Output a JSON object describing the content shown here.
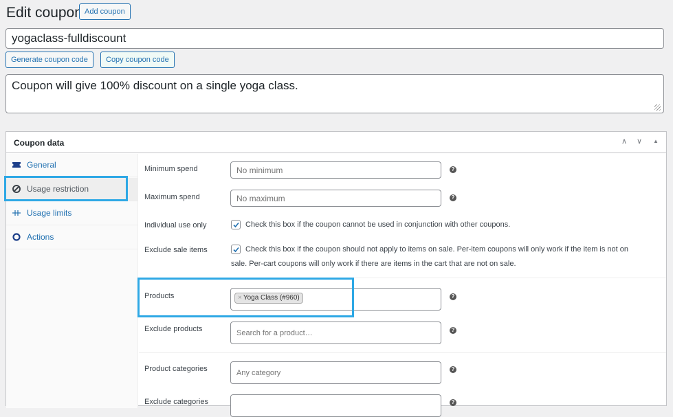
{
  "header": {
    "title": "Edit coupon",
    "add_coupon_label": "Add coupon"
  },
  "coupon": {
    "code": "yogaclass-fulldiscount",
    "generate_label": "Generate coupon code",
    "copy_label": "Copy coupon code",
    "description": "Coupon will give 100% discount on a single yoga class."
  },
  "panel": {
    "title": "Coupon data",
    "controls": {
      "move_up": "∧",
      "move_down": "∨",
      "toggle": "▲"
    },
    "tabs": [
      {
        "label": "General",
        "icon": "ticket-icon",
        "active": false
      },
      {
        "label": "Usage restriction",
        "icon": "block-icon",
        "active": true
      },
      {
        "label": "Usage limits",
        "icon": "limits-icon",
        "active": false
      },
      {
        "label": "Actions",
        "icon": "gear-icon",
        "active": false
      }
    ]
  },
  "restriction": {
    "min_spend": {
      "label": "Minimum spend",
      "placeholder": "No minimum",
      "value": ""
    },
    "max_spend": {
      "label": "Maximum spend",
      "placeholder": "No maximum",
      "value": ""
    },
    "individual_use": {
      "label": "Individual use only",
      "checked": true,
      "text": "Check this box if the coupon cannot be used in conjunction with other coupons."
    },
    "exclude_sale": {
      "label": "Exclude sale items",
      "checked": true,
      "text_line1": "Check this box if the coupon should not apply to items on sale. Per-item coupons will only work if the item is not on",
      "text_line2": "sale. Per-cart coupons will only work if there are items in the cart that are not on sale."
    },
    "products": {
      "label": "Products",
      "selected": [
        {
          "remove": "×",
          "name": "Yoga Class (#960)"
        }
      ]
    },
    "exclude_products": {
      "label": "Exclude products",
      "placeholder": "Search for a product…"
    },
    "product_categories": {
      "label": "Product categories",
      "placeholder": "Any category"
    },
    "exclude_categories": {
      "label": "Exclude categories"
    },
    "help_glyph": "?"
  },
  "colors": {
    "accent": "#2271b1",
    "highlight": "#2ea8e5"
  }
}
